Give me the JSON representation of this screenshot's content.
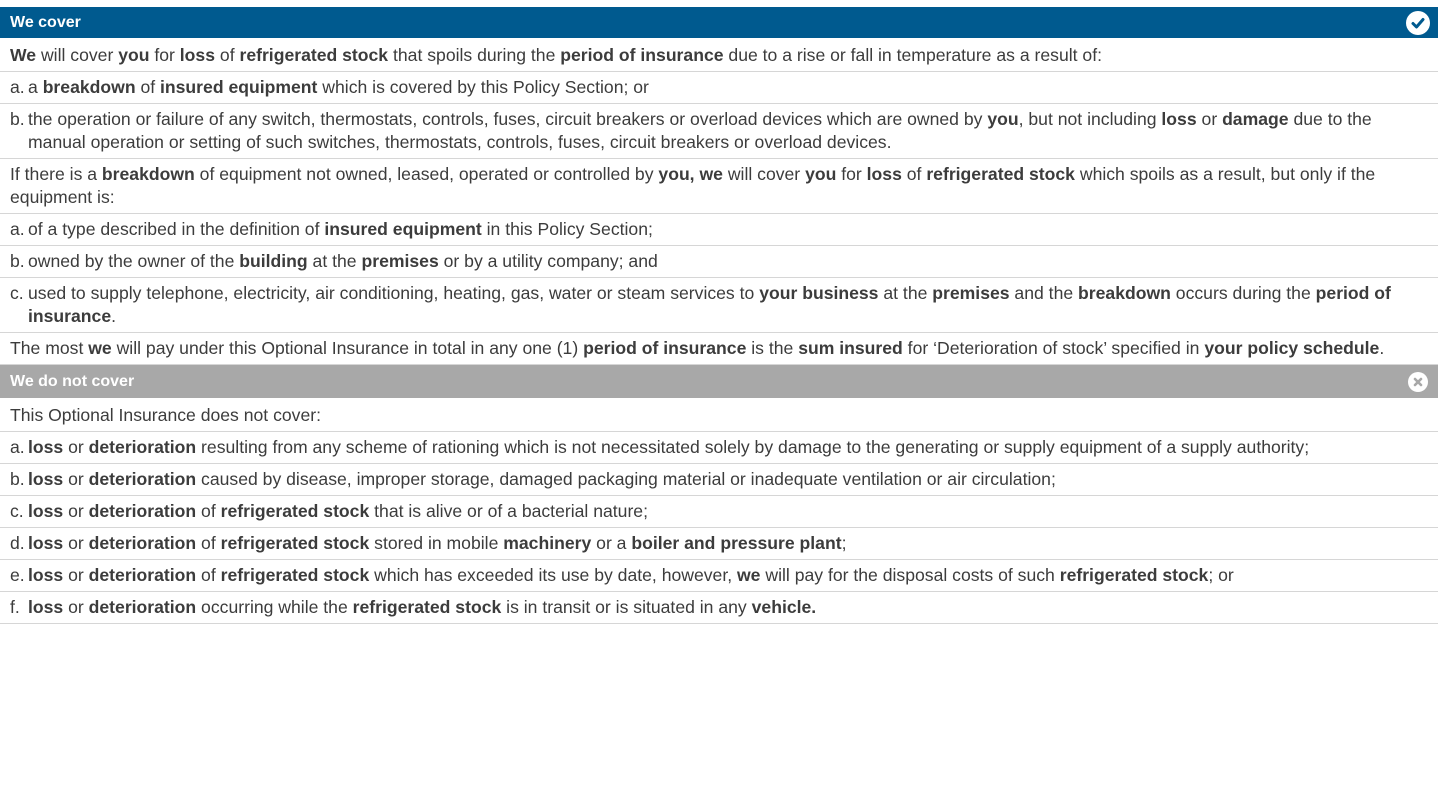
{
  "cover": {
    "title": "We cover",
    "icon": "checkmark-circle-icon",
    "color": "#005a8f",
    "intro": "<b>We</b> will cover <b>you</b> for <b>loss</b> of <b>refrigerated stock</b> that spoils during the <b>period of insurance</b> due to a rise or fall in temperature as a result of:",
    "items_a": [
      {
        "marker": "a.",
        "html": "a <b>breakdown</b> of <b>insured equipment</b> which is covered by this Policy Section; or"
      },
      {
        "marker": "b.",
        "html": "the operation or failure of any switch, thermostats, controls, fuses, circuit breakers or overload devices which are owned by <b>you</b>, but not including <b>loss</b> or <b>damage</b> due to the manual operation or setting of such switches, thermostats, controls, fuses, circuit breakers or overload devices."
      }
    ],
    "para2": "If there is a <b>breakdown</b> of equipment not owned, leased, operated or controlled by <b>you, we</b> will cover <b>you</b> for <b>loss</b> of <b>refrigerated stock</b> which spoils as a result, but only if the equipment is:",
    "items_b": [
      {
        "marker": "a.",
        "html": "of a type described in the definition of <b>insured equipment</b> in this Policy Section;"
      },
      {
        "marker": "b.",
        "html": "owned by the owner of the <b>building</b> at the <b>premises</b> or by a utility company; and"
      },
      {
        "marker": "c.",
        "html": "used to supply telephone, electricity, air conditioning, heating, gas, water or steam services to <b>your business</b> at the <b>premises</b> and the <b>breakdown</b> occurs during the <b>period of insurance</b>."
      }
    ],
    "para3": "The most <b>we</b> will pay under this Optional Insurance in total in any one (1) <b>period of insurance</b> is the <b>sum insured</b> for ‘Deterioration of stock’ specified in <b>your policy schedule</b>."
  },
  "notcover": {
    "title": "We do not cover",
    "icon": "cross-circle-icon",
    "color": "#a8a8a8",
    "intro": "This Optional Insurance does not cover:",
    "items": [
      {
        "marker": "a.",
        "html": "<b>loss</b> or <b>deterioration</b> resulting from any scheme of rationing which is not necessitated solely by damage to the generating or supply equipment of a supply authority;"
      },
      {
        "marker": "b.",
        "html": "<b>loss</b> or <b>deterioration</b> caused by disease, improper storage, damaged packaging material or inadequate ventilation or air circulation;"
      },
      {
        "marker": "c.",
        "html": "<b>loss</b> or <b>deterioration</b> of <b>refrigerated stock</b> that is alive or of a bacterial nature;"
      },
      {
        "marker": "d.",
        "html": "<b>loss</b> or <b>deterioration</b> of <b>refrigerated stock</b> stored in mobile <b>machinery</b> or a <b>boiler and pressure plant</b>;"
      },
      {
        "marker": "e.",
        "html": "<b>loss</b> or <b>deterioration</b> of <b>refrigerated stock</b> which has exceeded its use by date, however, <b>we</b> will pay for the disposal costs of such <b>refrigerated stock</b>; or"
      },
      {
        "marker": "f.",
        "html": "<b>loss</b> or <b>deterioration</b> occurring while the <b>refrigerated stock</b> is in transit or is situated in any <b>vehicle.</b>"
      }
    ]
  }
}
